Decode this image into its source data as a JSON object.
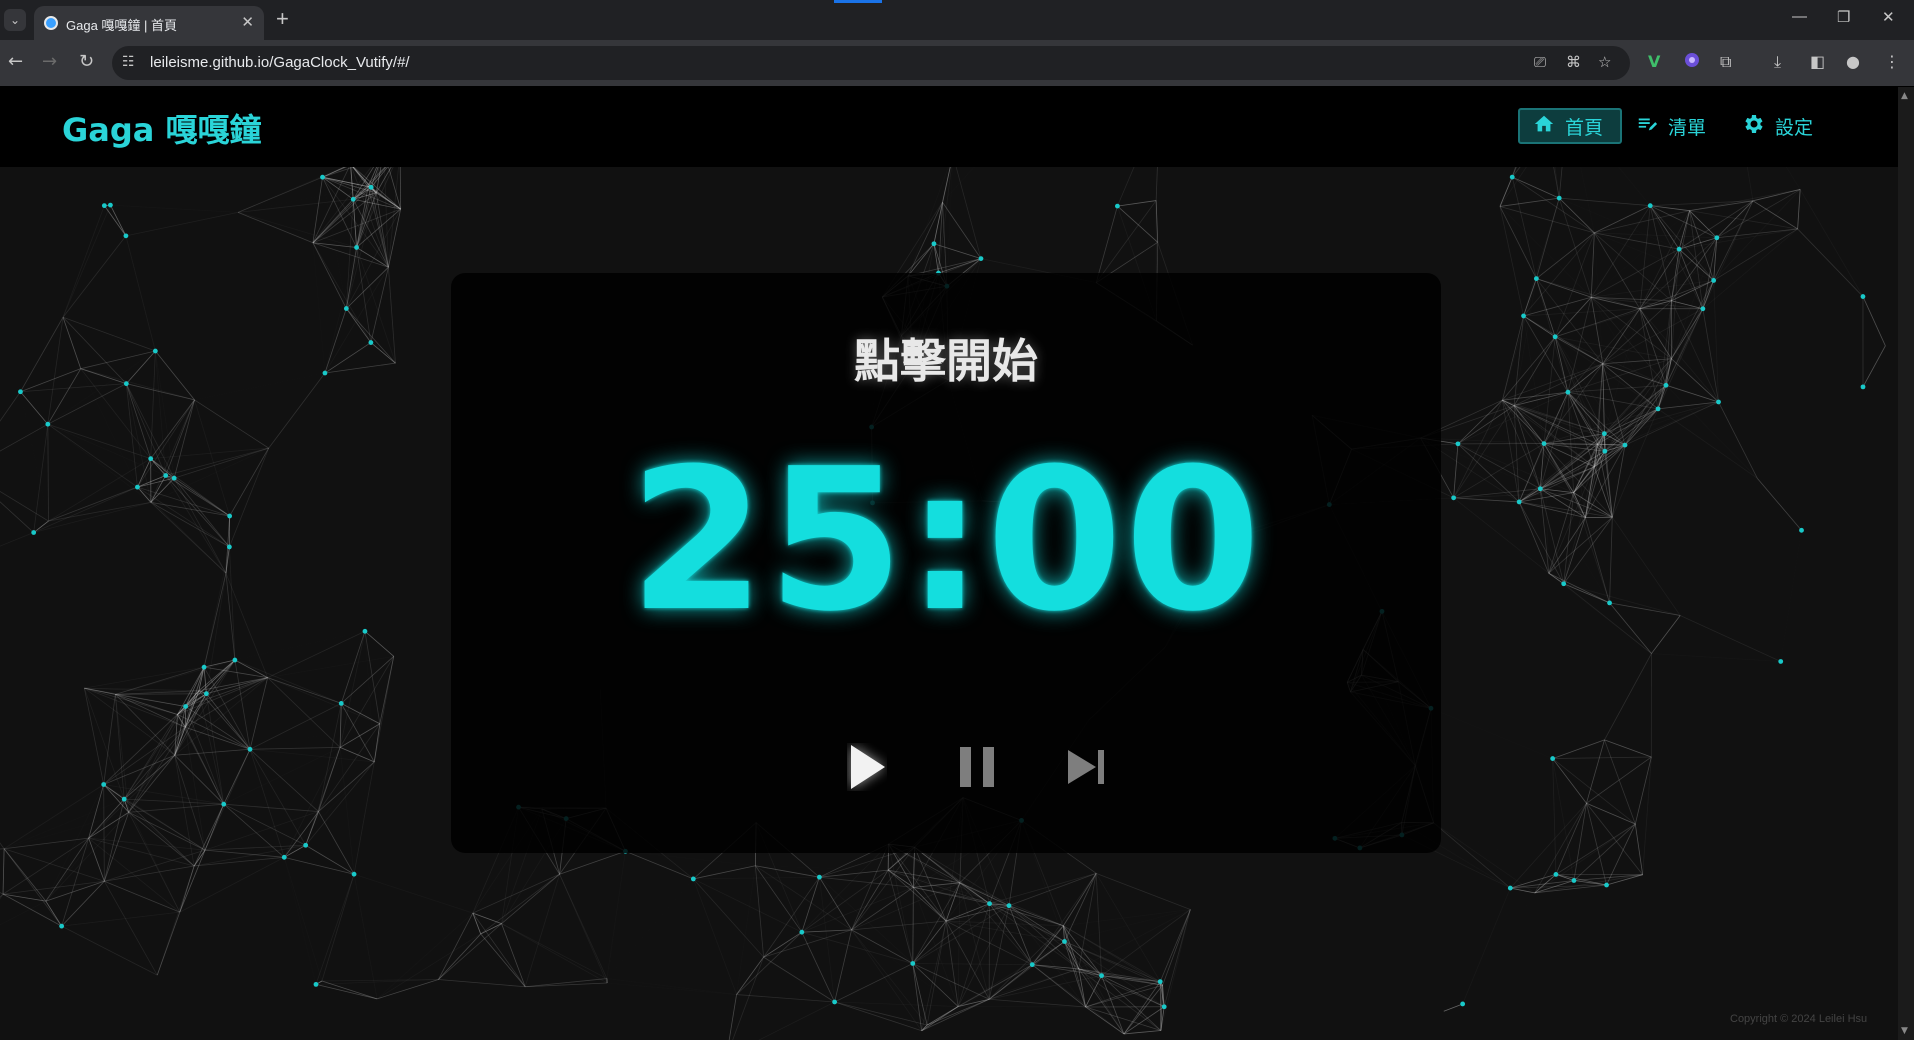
{
  "browser": {
    "tab_title": "Gaga 嘎嘎鐘 | 首頁",
    "url": "leileisme.github.io/GagaClock_Vutify/#/"
  },
  "app": {
    "brand": "Gaga 嘎嘎鐘",
    "nav": [
      {
        "label": "首頁",
        "icon": "home-icon",
        "active": true
      },
      {
        "label": "清單",
        "icon": "playlist-edit-icon",
        "active": false
      },
      {
        "label": "設定",
        "icon": "gear-icon",
        "active": false
      }
    ],
    "accent_color": "#14dede"
  },
  "timer": {
    "status": "點擊開始",
    "time": "25:00",
    "controls": [
      "play-icon",
      "pause-icon",
      "skip-next-icon"
    ]
  },
  "footer": {
    "copyright": "Copyright © 2024 Leilei Hsu"
  }
}
